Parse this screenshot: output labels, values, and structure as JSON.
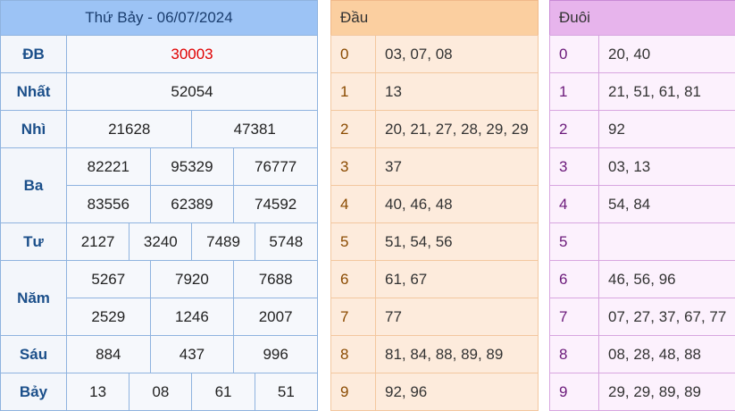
{
  "results": {
    "title": "Thứ Bảy - 06/07/2024",
    "db": {
      "label": "ĐB",
      "value": "30003"
    },
    "nhat": {
      "label": "Nhất",
      "value": "52054"
    },
    "nhi": {
      "label": "Nhì",
      "values": [
        "21628",
        "47381"
      ]
    },
    "ba": {
      "label": "Ba",
      "values": [
        "82221",
        "95329",
        "76777",
        "83556",
        "62389",
        "74592"
      ]
    },
    "tu": {
      "label": "Tư",
      "values": [
        "2127",
        "3240",
        "7489",
        "5748"
      ]
    },
    "nam": {
      "label": "Năm",
      "values": [
        "5267",
        "7920",
        "7688",
        "2529",
        "1246",
        "2007"
      ]
    },
    "sau": {
      "label": "Sáu",
      "values": [
        "884",
        "437",
        "996"
      ]
    },
    "bay": {
      "label": "Bảy",
      "values": [
        "13",
        "08",
        "61",
        "51"
      ]
    }
  },
  "dau": {
    "header": "Đầu",
    "rows": [
      {
        "digit": "0",
        "values": "03, 07, 08"
      },
      {
        "digit": "1",
        "values": "13"
      },
      {
        "digit": "2",
        "values": "20, 21, 27, 28, 29, 29"
      },
      {
        "digit": "3",
        "values": "37"
      },
      {
        "digit": "4",
        "values": "40, 46, 48"
      },
      {
        "digit": "5",
        "values": "51, 54, 56"
      },
      {
        "digit": "6",
        "values": "61, 67"
      },
      {
        "digit": "7",
        "values": "77"
      },
      {
        "digit": "8",
        "values": "81, 84, 88, 89, 89"
      },
      {
        "digit": "9",
        "values": "92, 96"
      }
    ]
  },
  "duoi": {
    "header": "Đuôi",
    "rows": [
      {
        "digit": "0",
        "values": "20, 40"
      },
      {
        "digit": "1",
        "values": "21, 51, 61, 81"
      },
      {
        "digit": "2",
        "values": "92"
      },
      {
        "digit": "3",
        "values": "03, 13"
      },
      {
        "digit": "4",
        "values": "54, 84"
      },
      {
        "digit": "5",
        "values": ""
      },
      {
        "digit": "6",
        "values": "46, 56, 96"
      },
      {
        "digit": "7",
        "values": "07, 27, 37, 67, 77"
      },
      {
        "digit": "8",
        "values": "08, 28, 48, 88"
      },
      {
        "digit": "9",
        "values": "29, 29, 89, 89"
      }
    ]
  },
  "colors": {
    "header_blue": "#9cc3f5",
    "label_blue": "#1b4f8a",
    "special_red": "#e00000",
    "dau_header": "#fbcfa0",
    "duoi_header": "#e7b4ec"
  }
}
